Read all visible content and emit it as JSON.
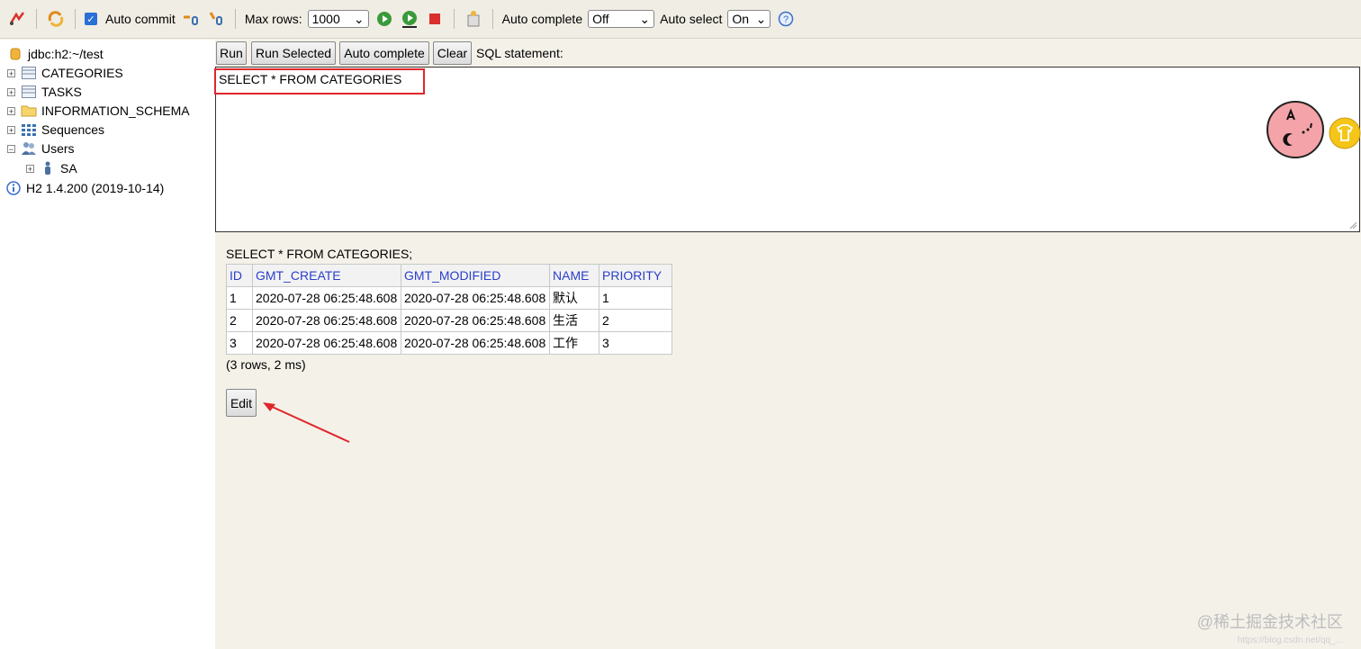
{
  "toolbar": {
    "auto_commit_label": "Auto commit",
    "max_rows_label": "Max rows:",
    "max_rows_value": "1000",
    "auto_complete_label": "Auto complete",
    "auto_complete_value": "Off",
    "auto_select_label": "Auto select",
    "auto_select_value": "On",
    "help_glyph": "?"
  },
  "tree": {
    "connection": "jdbc:h2:~/test",
    "items": [
      {
        "label": "CATEGORIES",
        "icon": "table-icon"
      },
      {
        "label": "TASKS",
        "icon": "table-icon"
      },
      {
        "label": "INFORMATION_SCHEMA",
        "icon": "folder-icon"
      },
      {
        "label": "Sequences",
        "icon": "sequences-icon"
      },
      {
        "label": "Users",
        "icon": "users-icon"
      }
    ],
    "sub_user": "SA",
    "version": "H2 1.4.200 (2019-10-14)"
  },
  "buttons": {
    "run": "Run",
    "run_selected": "Run Selected",
    "auto_complete": "Auto complete",
    "clear": "Clear",
    "sql_statement_label": "SQL statement:"
  },
  "editor": {
    "sql": "SELECT * FROM CATEGORIES"
  },
  "result": {
    "statement": "SELECT * FROM CATEGORIES;",
    "columns": [
      "ID",
      "GMT_CREATE",
      "GMT_MODIFIED",
      "NAME",
      "PRIORITY"
    ],
    "rows": [
      [
        "1",
        "2020-07-28 06:25:48.608",
        "2020-07-28 06:25:48.608",
        "默认",
        "1"
      ],
      [
        "2",
        "2020-07-28 06:25:48.608",
        "2020-07-28 06:25:48.608",
        "生活",
        "2"
      ],
      [
        "3",
        "2020-07-28 06:25:48.608",
        "2020-07-28 06:25:48.608",
        "工作",
        "3"
      ]
    ],
    "summary": "(3 rows, 2 ms)",
    "edit_button": "Edit"
  },
  "watermark": {
    "main": "@稀土掘金技术社区",
    "sub": "https://blog.csdn.net/qq_..."
  },
  "colors": {
    "highlight": "#e0262b",
    "header_link": "#2a3fc9",
    "run_green": "#3a9a3a",
    "stop_red": "#d9302c"
  }
}
